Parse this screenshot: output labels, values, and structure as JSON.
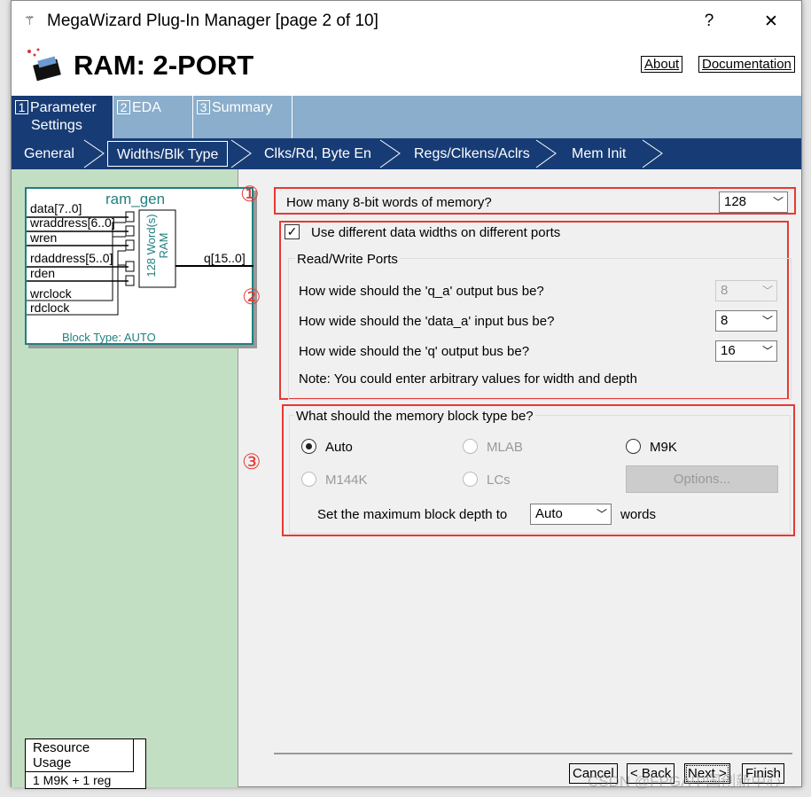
{
  "window": {
    "title": "MegaWizard Plug-In Manager [page 2 of 10]",
    "help": "?",
    "close": "✕"
  },
  "header": {
    "title": "RAM: 2-PORT",
    "about": "About",
    "documentation": "Documentation"
  },
  "tabs": [
    {
      "num": "1",
      "label": "Parameter Settings",
      "line1": "Parameter",
      "line2": "Settings"
    },
    {
      "num": "2",
      "label": "EDA"
    },
    {
      "num": "3",
      "label": "Summary"
    }
  ],
  "nav": [
    "General",
    "Widths/Blk Type",
    "Clks/Rd, Byte En",
    "Regs/Clkens/Aclrs",
    "Mem Init"
  ],
  "symbol": {
    "name": "ram_gen",
    "inputs": [
      "data[7..0]",
      "wraddress[6..0]",
      "wren",
      "rdaddress[5..0]",
      "rden",
      "wrclock",
      "rdclock"
    ],
    "output": "q[15..0]",
    "block_line1": "128 Word(s)",
    "block_line2": "RAM",
    "block_type": "Block Type: AUTO"
  },
  "resource": {
    "label": "Resource Usage",
    "value": "1 M9K + 1 reg"
  },
  "annotations": [
    "①",
    "②",
    "③"
  ],
  "words": {
    "label": "How many 8-bit words of memory?",
    "value": "128"
  },
  "widths": {
    "checkbox_label": "Use different data widths on different ports",
    "checked": true,
    "group": "Read/Write Ports",
    "rows": [
      {
        "label": "How wide should the 'q_a' output bus be?",
        "value": "8",
        "disabled": true
      },
      {
        "label": "How wide should the 'data_a' input bus be?",
        "value": "8"
      },
      {
        "label": "How wide should the 'q' output bus be?",
        "value": "16"
      }
    ],
    "note": "Note: You could enter arbitrary values for width and depth"
  },
  "blocktype": {
    "group": "What should the memory block type be?",
    "options": [
      {
        "label": "Auto",
        "selected": true
      },
      {
        "label": "MLAB",
        "disabled": true
      },
      {
        "label": "M9K"
      },
      {
        "label": "M144K",
        "disabled": true
      },
      {
        "label": "LCs",
        "disabled": true
      }
    ],
    "options_button": "Options...",
    "depth_label": "Set the maximum block depth to",
    "depth_value": "Auto",
    "depth_suffix": "words"
  },
  "footer": {
    "cancel": "Cancel",
    "back": "< Back",
    "next": "Next >",
    "finish": "Finish"
  },
  "watermark": "CSDN @FPGA中国创新中心",
  "colors": {
    "nav_blue": "#173c75",
    "tab_blue": "#8aaecb",
    "left_green": "#c3dfc3",
    "annotation_red": "#e53935"
  }
}
